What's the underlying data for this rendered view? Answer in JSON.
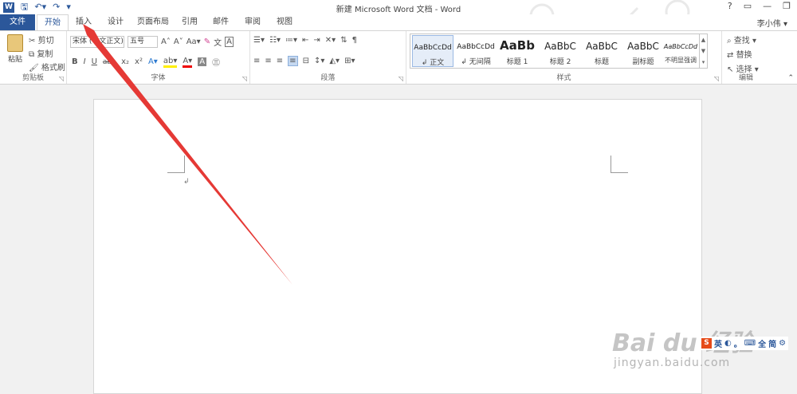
{
  "window": {
    "title": "新建 Microsoft Word 文档 - Word",
    "user": "李小伟",
    "controls": [
      "?",
      "▭",
      "—",
      "❐"
    ]
  },
  "qat": {
    "icons": [
      "save-icon",
      "undo-icon",
      "redo-icon",
      "customize-icon"
    ]
  },
  "tabs": [
    {
      "label": "文件"
    },
    {
      "label": "开始"
    },
    {
      "label": "插入"
    },
    {
      "label": "设计"
    },
    {
      "label": "页面布局"
    },
    {
      "label": "引用"
    },
    {
      "label": "邮件"
    },
    {
      "label": "审阅"
    },
    {
      "label": "视图"
    }
  ],
  "clipboard": {
    "paste": "粘贴",
    "cut": "剪切",
    "copy": "复制",
    "format_painter": "格式刷",
    "label": "剪贴板"
  },
  "font": {
    "name": "宋体 (中文正文)",
    "size": "五号",
    "label": "字体",
    "grow": "A",
    "shrink": "A",
    "case": "Aa",
    "bold": "B",
    "italic": "I",
    "underline": "U",
    "strike": "abc",
    "sub": "x₂",
    "sup": "x²"
  },
  "paragraph": {
    "label": "段落"
  },
  "styles": {
    "label": "样式",
    "items": [
      {
        "sample": "AaBbCcDd",
        "name": "↲ 正文"
      },
      {
        "sample": "AaBbCcDd",
        "name": "↲ 无间隔"
      },
      {
        "sample": "AaBb",
        "name": "标题 1"
      },
      {
        "sample": "AaBbC",
        "name": "标题 2"
      },
      {
        "sample": "AaBbC",
        "name": "标题"
      },
      {
        "sample": "AaBbC",
        "name": "副标题"
      },
      {
        "sample": "AaBbCcDd",
        "name": "不明显强调"
      }
    ]
  },
  "editing": {
    "find": "查找",
    "replace": "替换",
    "select": "选择",
    "label": "编辑"
  },
  "document": {
    "paragraph_mark": "↲"
  },
  "ime": {
    "icon": "S",
    "items": [
      "英",
      "◐",
      "。",
      "⌨",
      "全",
      "简",
      "⚙"
    ]
  },
  "watermark": {
    "brand": "Bai du 经验",
    "url": "jingyan.baidu.com"
  },
  "colors": {
    "accent": "#2b579a",
    "arrow": "#e53935"
  }
}
